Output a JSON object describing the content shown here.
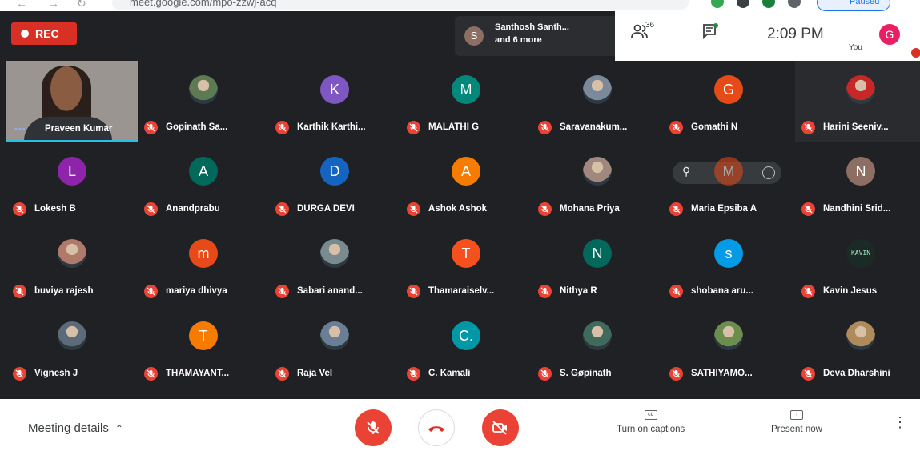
{
  "browser": {
    "url": "meet.google.com/mpo-zzwj-acq",
    "profile": "Paused"
  },
  "recording": {
    "label": "REC"
  },
  "presenter": {
    "avatar": "S",
    "line1": "Santhosh Santh...",
    "line2": "and 6 more"
  },
  "toolbar": {
    "people_count": "36",
    "time": "2:09 PM",
    "you_label": "You",
    "you_avatar": "G"
  },
  "self_tile": {
    "dots": "•••",
    "name": "Praveen Kumar"
  },
  "hover": {
    "avatar_letter": "M"
  },
  "participants": [
    {
      "name": "Gopinath Sa...",
      "avatar": "",
      "type": "photo",
      "color": "#5d7a52"
    },
    {
      "name": "Karthik Karthi...",
      "avatar": "K",
      "type": "letter",
      "color": "#7e57c2"
    },
    {
      "name": "MALATHI G",
      "avatar": "M",
      "type": "letter",
      "color": "#00897b"
    },
    {
      "name": "Saravanakum...",
      "avatar": "",
      "type": "photo",
      "color": "#7a8a9a"
    },
    {
      "name": "Gomathi N",
      "avatar": "G",
      "type": "letter",
      "color": "#e64a19"
    },
    {
      "name": "Harini Seeniv...",
      "avatar": "",
      "type": "photo",
      "color": "#c62828"
    },
    {
      "name": "Lokesh B",
      "avatar": "L",
      "type": "letter",
      "color": "#8e24aa"
    },
    {
      "name": "Anandprabu",
      "avatar": "A",
      "type": "letter",
      "color": "#00695c"
    },
    {
      "name": "DURGA DEVI",
      "avatar": "D",
      "type": "letter",
      "color": "#1565c0"
    },
    {
      "name": "Ashok Ashok",
      "avatar": "A",
      "type": "letter",
      "color": "#f57c00"
    },
    {
      "name": "Mohana Priya",
      "avatar": "",
      "type": "photo",
      "color": "#a1887f"
    },
    {
      "name": "Maria Epsiba A",
      "avatar": "M",
      "type": "letter",
      "color": "#e64a19"
    },
    {
      "name": "Nandhini Srid...",
      "avatar": "N",
      "type": "letter",
      "color": "#8d6e63"
    },
    {
      "name": "buviya rajesh",
      "avatar": "",
      "type": "photo",
      "color": "#b07a6a"
    },
    {
      "name": "mariya dhivya",
      "avatar": "m",
      "type": "letter",
      "color": "#e64a19"
    },
    {
      "name": "Sabari anand...",
      "avatar": "",
      "type": "photo",
      "color": "#7a8b8f"
    },
    {
      "name": "Thamaraiselv...",
      "avatar": "T",
      "type": "letter",
      "color": "#f4511e"
    },
    {
      "name": "Nithya R",
      "avatar": "N",
      "type": "letter",
      "color": "#00695c"
    },
    {
      "name": "shobana aru...",
      "avatar": "s",
      "type": "letter",
      "color": "#039be5"
    },
    {
      "name": "Kavin Jesus",
      "avatar": "KAVIN",
      "type": "logo",
      "color": "#1b2a24"
    },
    {
      "name": "Vignesh J",
      "avatar": "",
      "type": "photo",
      "color": "#5c6b7a"
    },
    {
      "name": "THAMAYANT...",
      "avatar": "T",
      "type": "letter",
      "color": "#f57c00"
    },
    {
      "name": "Raja Vel",
      "avatar": "",
      "type": "photo",
      "color": "#6a7f95"
    },
    {
      "name": "C. Kamali",
      "avatar": "C.",
      "type": "letter",
      "color": "#0097a7"
    },
    {
      "name": "S. Gøpinath",
      "avatar": "",
      "type": "photo",
      "color": "#3e6b5c"
    },
    {
      "name": "SATHIYAMO...",
      "avatar": "",
      "type": "photo",
      "color": "#6b8e4e"
    },
    {
      "name": "Deva Dharshini",
      "avatar": "",
      "type": "photo",
      "color": "#b08b5a"
    }
  ],
  "bottom": {
    "meeting_details": "Meeting details",
    "captions_label": "Turn on captions",
    "captions_icon": "cc-icon",
    "present_label": "Present now",
    "present_icon": "present-icon"
  },
  "colors": {
    "danger": "#ea4335",
    "accent": "#1a73e8",
    "bg": "#202124"
  }
}
